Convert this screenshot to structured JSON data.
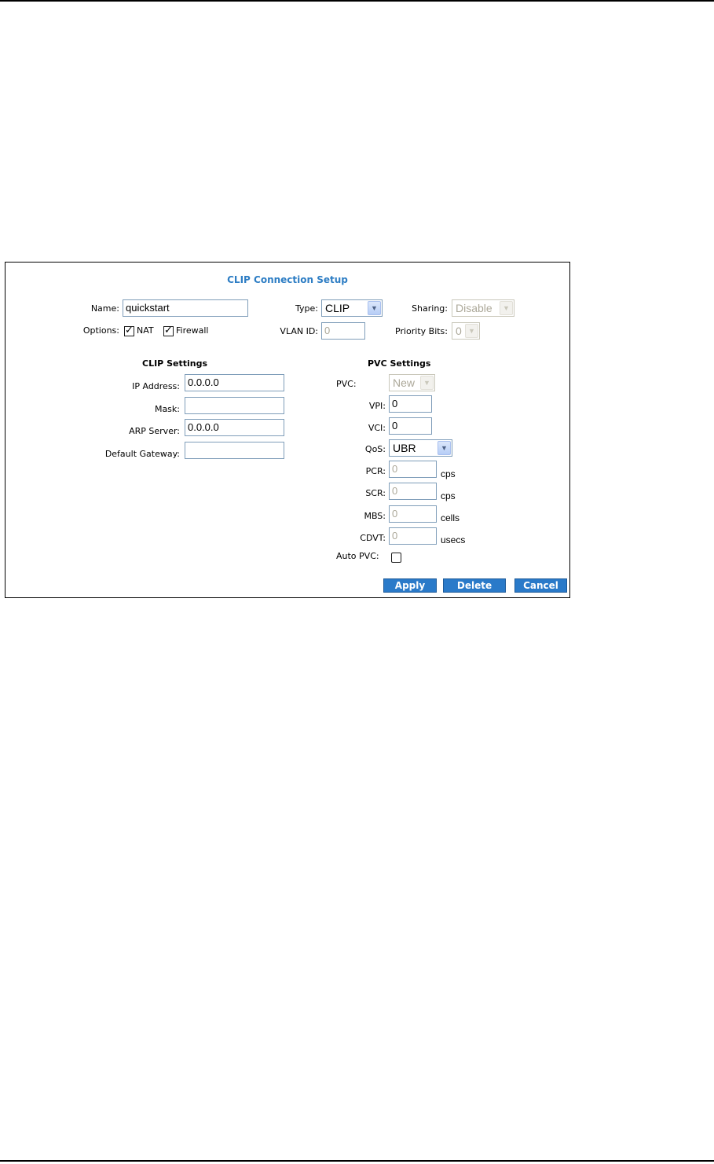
{
  "title": "CLIP Connection Setup",
  "top": {
    "name_label": "Name:",
    "name_value": "quickstart",
    "type_label": "Type:",
    "type_value": "CLIP",
    "sharing_label": "Sharing:",
    "sharing_value": "Disable",
    "options_label": "Options:",
    "nat_label": "NAT",
    "nat_checked": true,
    "firewall_label": "Firewall",
    "firewall_checked": true,
    "vlan_label": "VLAN ID:",
    "vlan_value": "0",
    "priority_label": "Priority Bits:",
    "priority_value": "0"
  },
  "clip": {
    "heading": "CLIP Settings",
    "ip_label": "IP Address:",
    "ip_value": "0.0.0.0",
    "mask_label": "Mask:",
    "mask_value": "",
    "arp_label": "ARP Server:",
    "arp_value": "0.0.0.0",
    "gw_label": "Default Gateway:",
    "gw_value": ""
  },
  "pvc": {
    "heading": "PVC Settings",
    "pvc_label": "PVC:",
    "pvc_value": "New",
    "vpi_label": "VPI:",
    "vpi_value": "0",
    "vci_label": "VCI:",
    "vci_value": "0",
    "qos_label": "QoS:",
    "qos_value": "UBR",
    "pcr_label": "PCR:",
    "pcr_value": "0",
    "pcr_unit": "cps",
    "scr_label": "SCR:",
    "scr_value": "0",
    "scr_unit": "cps",
    "mbs_label": "MBS:",
    "mbs_value": "0",
    "mbs_unit": "cells",
    "cdvt_label": "CDVT:",
    "cdvt_value": "0",
    "cdvt_unit": "usecs",
    "auto_label": "Auto PVC:",
    "auto_checked": false
  },
  "buttons": {
    "apply": "Apply",
    "delete": "Delete",
    "cancel": "Cancel"
  },
  "colors": {
    "title": "#2d7dc4",
    "button": "#2a7ac9",
    "input_border": "#7f9db9"
  }
}
